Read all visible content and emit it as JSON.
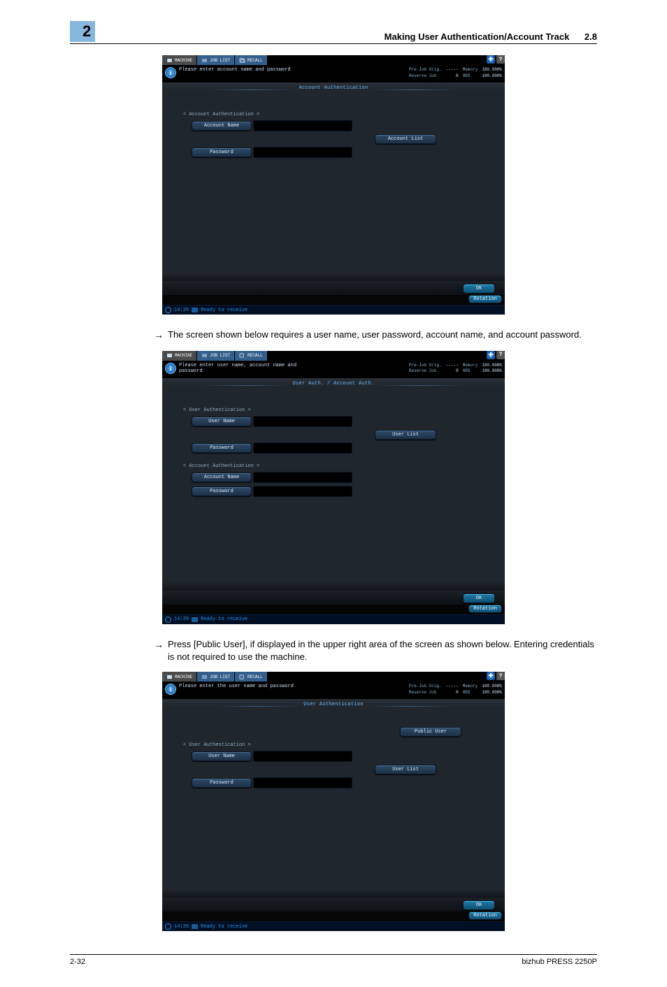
{
  "header": {
    "chapter_number": "2",
    "title": "Making User Authentication/Account Track",
    "section_number": "2.8"
  },
  "paragraphs": {
    "p1": "The screen shown below requires a user name, user password, account name, and account password.",
    "p2": "Press [Public User], if displayed in the upper right area of the screen as shown below. Entering credentials is not required to use the machine."
  },
  "screen": {
    "tabs": {
      "machine": "MACHINE",
      "joblist": "JOB LIST",
      "recall": "RECALL"
    },
    "status": {
      "row1_label": "Pre-Job Orig.",
      "row1_val": "-----",
      "row1_label2": "Memory",
      "row1_val2": "100.000%",
      "row2_label": "Reserve Job",
      "row2_val": "0",
      "row2_label2": "HDD",
      "row2_val2": "100.000%"
    },
    "status_line": {
      "time": "14:39",
      "msg": "Ready to receive"
    },
    "buttons": {
      "account_name": "Account Name",
      "password": "Password",
      "account_list": "Account List",
      "user_name": "User Name",
      "user_list": "User List",
      "public_user": "Public User",
      "ok": "OK",
      "rotation": "Rotation"
    },
    "s1": {
      "info_msg": "Please enter account name and password",
      "panel_header": "Account Authentication",
      "section1": "< Account Authentication >"
    },
    "s2": {
      "info_msg": "Please enter user name, account name and password",
      "panel_header": "User Auth. / Account Auth.",
      "section1": "< User Authentication >",
      "section2": "< Account Authentication >"
    },
    "s3": {
      "info_msg": "Please enter the user name and password",
      "panel_header": "User Authentication",
      "section1": "< User Authentication >"
    }
  },
  "footer": {
    "page": "2-32",
    "model": "bizhub PRESS 2250P"
  }
}
